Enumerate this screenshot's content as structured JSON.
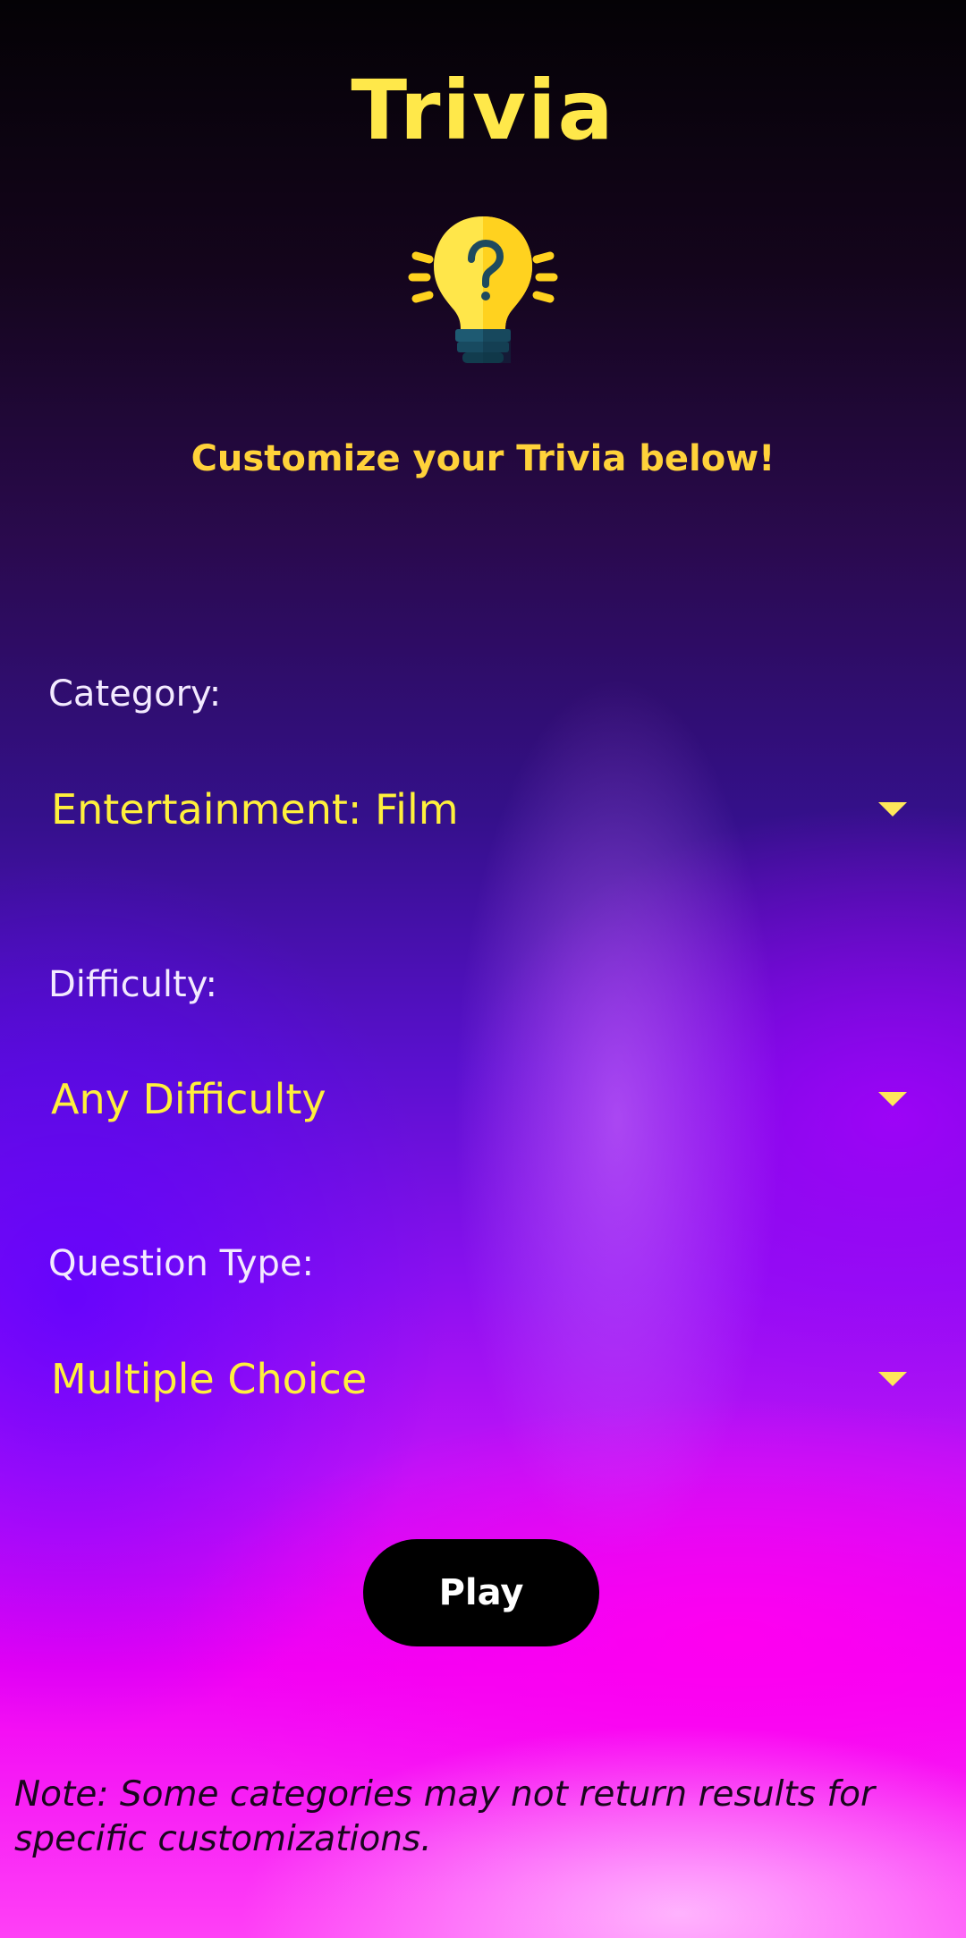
{
  "header": {
    "title": "Trivia",
    "icon": "lightbulb-question-icon",
    "tagline": "Customize your Trivia below!"
  },
  "form": {
    "category": {
      "label": "Category:",
      "value": "Entertainment: Film"
    },
    "difficulty": {
      "label": "Difficulty:",
      "value": "Any Difficulty"
    },
    "question_type": {
      "label": "Question Type:",
      "value": "Multiple Choice"
    }
  },
  "actions": {
    "play_label": "Play"
  },
  "footer": {
    "note": "Note: Some categories may not return results for specific customizations."
  },
  "colors": {
    "accent_yellow": "#fff03c",
    "button_bg": "#000000",
    "label_text": "#f3eaff"
  }
}
